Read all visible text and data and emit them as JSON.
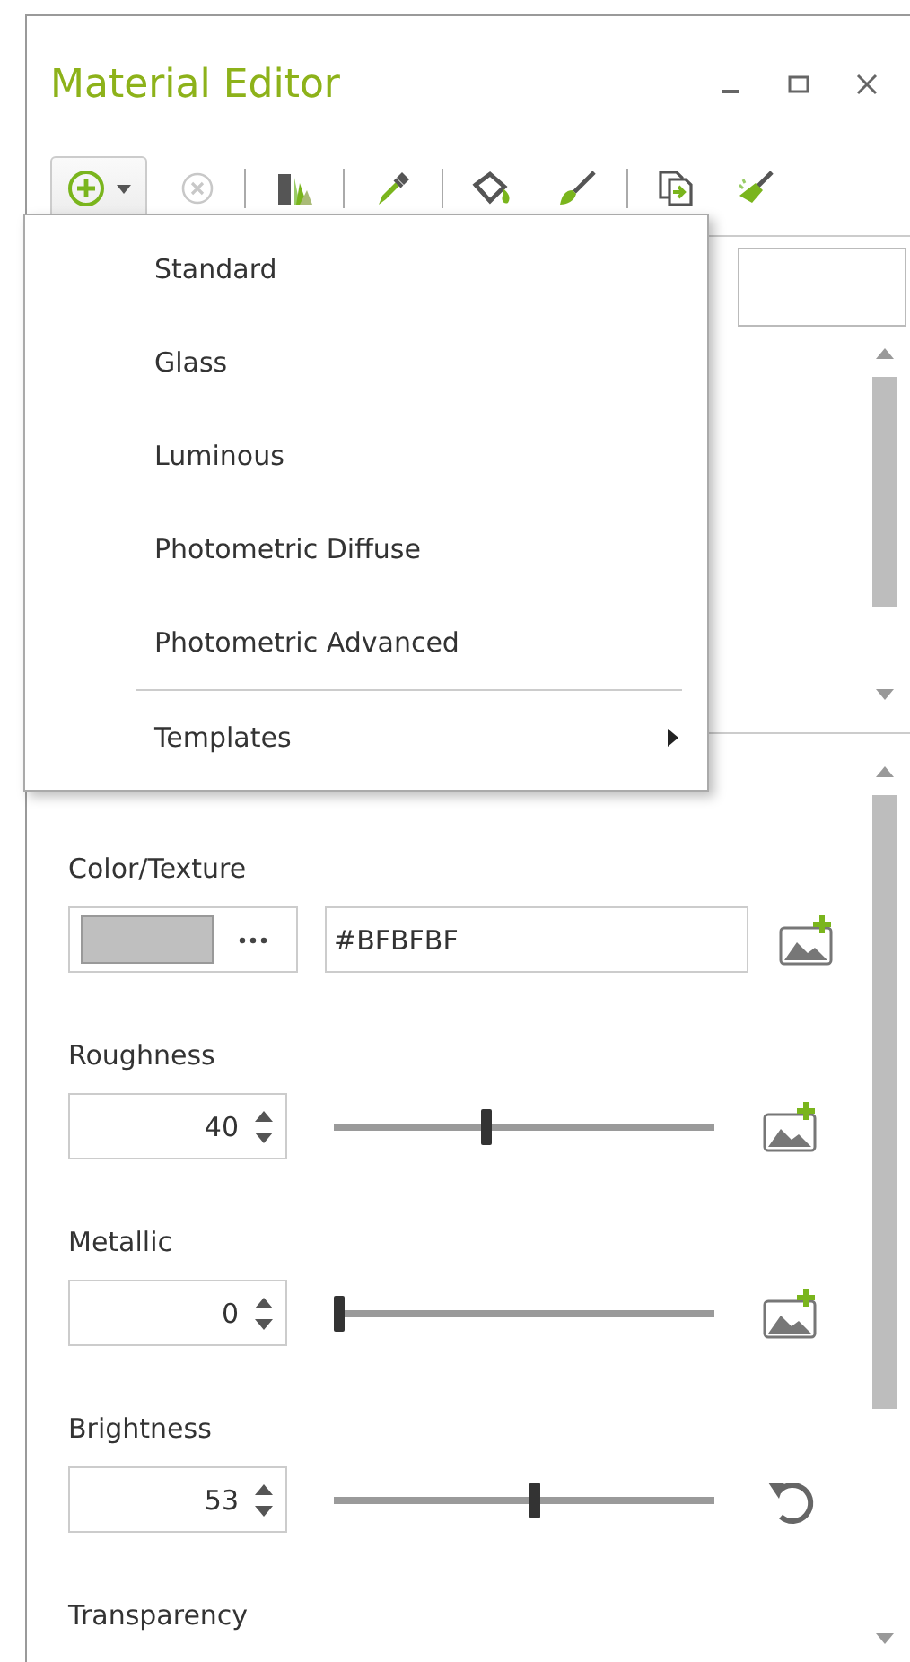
{
  "window": {
    "title": "Material Editor"
  },
  "toolbar": {
    "groups": [
      [
        {
          "kind": "add",
          "disabled": false
        },
        {
          "kind": "remove",
          "disabled": true
        }
      ],
      [
        {
          "kind": "library",
          "disabled": false
        }
      ],
      [
        {
          "kind": "eyedropper",
          "disabled": false
        }
      ],
      [
        {
          "kind": "bucket",
          "disabled": false
        },
        {
          "kind": "brush",
          "disabled": false
        }
      ],
      [
        {
          "kind": "copy",
          "disabled": false
        },
        {
          "kind": "broom",
          "disabled": false
        }
      ]
    ]
  },
  "menu": {
    "items": [
      {
        "kind": "item",
        "label": "Standard"
      },
      {
        "kind": "item",
        "label": "Glass"
      },
      {
        "kind": "item",
        "label": "Luminous"
      },
      {
        "kind": "item",
        "label": "Photometric Diffuse"
      },
      {
        "kind": "item",
        "label": "Photometric Advanced"
      },
      {
        "kind": "separator"
      },
      {
        "kind": "submenu",
        "label": "Templates"
      }
    ]
  },
  "properties": [
    {
      "kind": "color",
      "label": "Color/Texture",
      "color": "#bfbfbf",
      "value": "#BFBFBF",
      "texture_button": true,
      "reset_button": false
    },
    {
      "kind": "slider",
      "label": "Roughness",
      "value": "40",
      "level": 0.4,
      "texture_button": true,
      "reset_button": false
    },
    {
      "kind": "slider",
      "label": "Metallic",
      "value": "0",
      "level": 0,
      "texture_button": true,
      "reset_button": false
    },
    {
      "kind": "slider",
      "label": "Brightness",
      "value": "53",
      "level": 0.53,
      "texture_button": false,
      "reset_button": true
    },
    {
      "kind": "label",
      "label": "Transparency"
    }
  ]
}
